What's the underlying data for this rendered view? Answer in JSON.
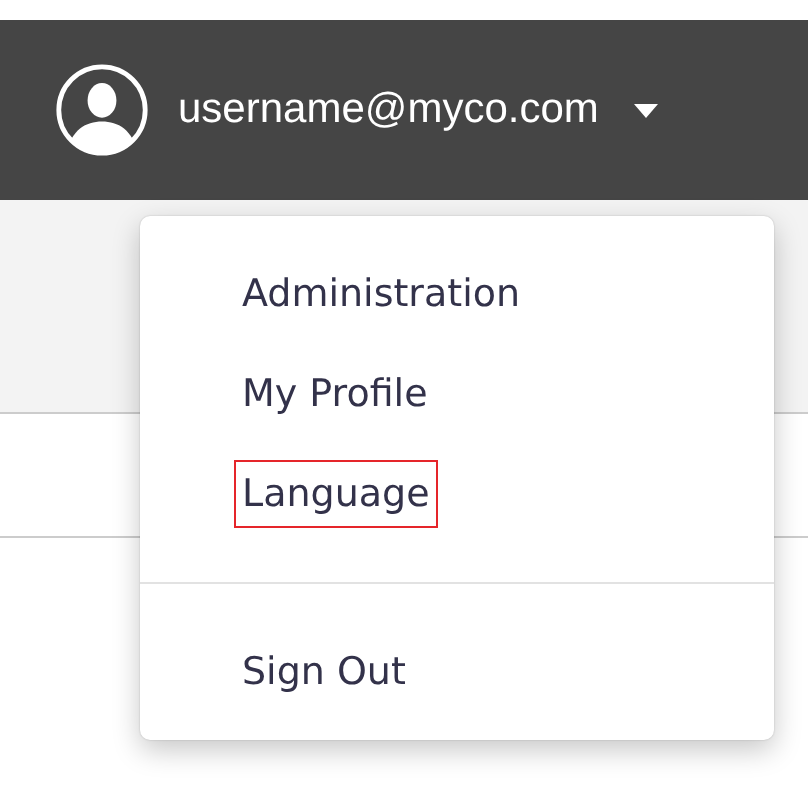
{
  "header": {
    "user": "username@myco.com"
  },
  "user_menu": {
    "sections": [
      [
        {
          "label": "Administration",
          "selected": false
        },
        {
          "label": "My Profile",
          "selected": false
        },
        {
          "label": "Language",
          "selected": true
        }
      ],
      [
        {
          "label": "Sign Out",
          "selected": false
        }
      ]
    ]
  }
}
